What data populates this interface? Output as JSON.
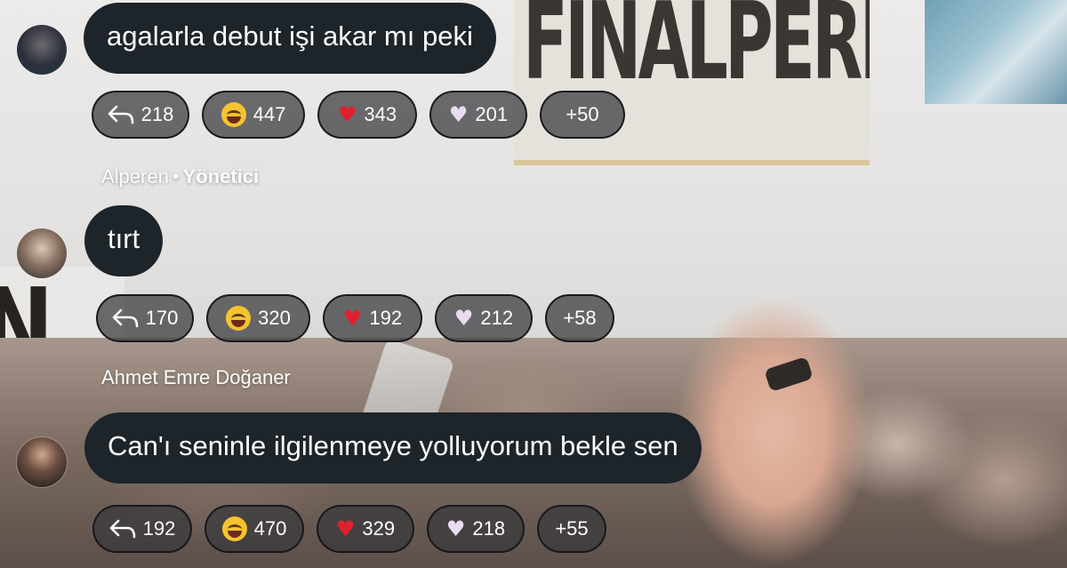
{
  "messages": [
    {
      "text": "agalarla debut işi akar mı peki",
      "avatar_icon": "user-avatar",
      "reactions": {
        "reply_count": "218",
        "laugh_count": "447",
        "heart_count": "343",
        "white_heart_count": "201",
        "more_count": "+50"
      }
    },
    {
      "sender_name": "Alperen",
      "sender_separator": "•",
      "sender_role": "Yönetici",
      "text": "tırt",
      "avatar_icon": "user-avatar",
      "reactions": {
        "reply_count": "170",
        "laugh_count": "320",
        "heart_count": "192",
        "white_heart_count": "212",
        "more_count": "+58"
      }
    },
    {
      "sender_name": "Ahmet Emre Doğaner",
      "text": "Can'ı seninle ilgilenmeye yolluyorum bekle sen",
      "avatar_icon": "user-avatar",
      "reactions": {
        "reply_count": "192",
        "laugh_count": "470",
        "heart_count": "329",
        "white_heart_count": "218",
        "more_count": "+55"
      }
    }
  ],
  "background": {
    "poster_text": "FINALPEREN"
  },
  "colors": {
    "bubble": "#1d242a",
    "chip_border": "#14161a",
    "heart": "#e0202f",
    "white_heart": "#e8dcf3",
    "laugh": "#f6c230"
  }
}
